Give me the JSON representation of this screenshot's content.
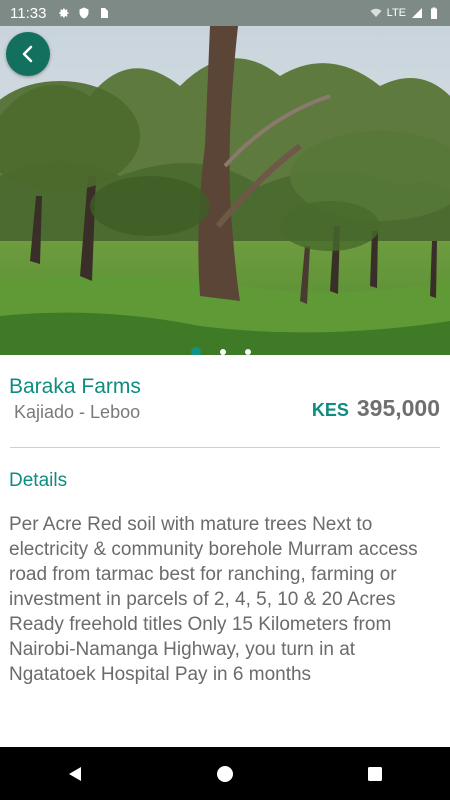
{
  "status_bar": {
    "time": "11:33",
    "network_label": "LTE",
    "icons": [
      "gear-icon",
      "shield-icon",
      "sim-card-icon",
      "wifi-icon",
      "signal-icon",
      "battery-icon"
    ]
  },
  "hero": {
    "image_description": "savanna field with acacia trees",
    "carousel_count": 3,
    "carousel_active_index": 0
  },
  "listing": {
    "name": "Baraka Farms",
    "location": "Kajiado - Leboo",
    "currency": "KES",
    "price": "395,000"
  },
  "details": {
    "title": "Details",
    "description": "Per Acre Red soil with mature trees Next to electricity & community borehole Murram access road from tarmac best for ranching, farming or investment in parcels of 2, 4, 5, 10 & 20 Acres Ready freehold titles Only 15 Kilometers from Nairobi-Namanga Highway, you turn in at Ngatatoek Hospital Pay in 6 months"
  },
  "colors": {
    "accent": "#0f8c7f",
    "back_button": "#14705e",
    "status_bar": "#7d8a86",
    "nav_bar": "#000000"
  },
  "navigation": {
    "buttons": [
      "back-triangle-icon",
      "home-circle-icon",
      "recents-square-icon"
    ]
  }
}
